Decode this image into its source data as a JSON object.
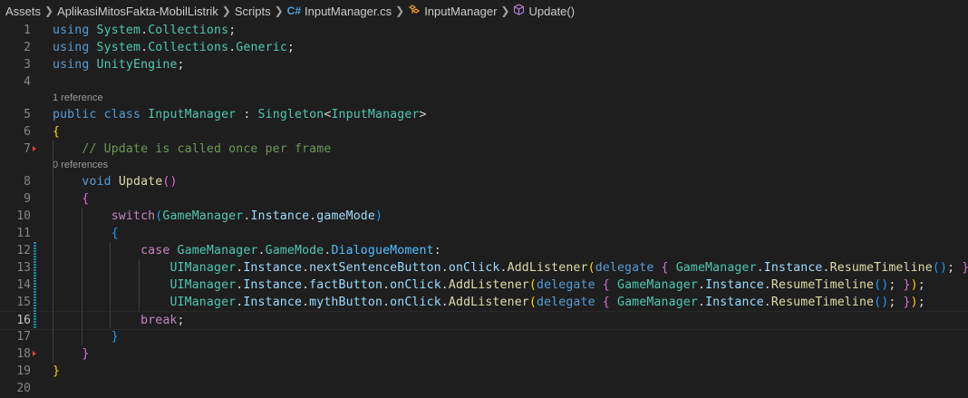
{
  "breadcrumb": {
    "items": [
      "Assets",
      "AplikasiMitosFakta-MobilListrik",
      "Scripts",
      "InputManager.cs",
      "InputManager",
      "Update()"
    ],
    "cs_glyph": "C#"
  },
  "lines": [
    {
      "n": "1",
      "html": "<span class='kw'>using</span> <span class='ns'>System</span>.<span class='ns'>Collections</span>;"
    },
    {
      "n": "2",
      "html": "<span class='kw'>using</span> <span class='ns'>System</span>.<span class='ns'>Collections</span>.<span class='ns'>Generic</span>;"
    },
    {
      "n": "3",
      "html": "<span class='kw'>using</span> <span class='ns'>UnityEngine</span>;"
    },
    {
      "n": "4",
      "html": ""
    },
    {
      "n": "5",
      "lens": "1 reference",
      "html": "<span class='kw'>public</span> <span class='kw'>class</span> <span class='cls'>InputManager</span> : <span class='cls'>Singleton</span>&lt;<span class='cls'>InputManager</span>&gt;"
    },
    {
      "n": "6",
      "html": "<span class='p1'>{</span>"
    },
    {
      "n": "7",
      "html": "    <span class='cm'>// Update is called once per frame</span>"
    },
    {
      "n": "8",
      "lens": "0 references",
      "html": "    <span class='kw'>void</span> <span class='fn'>Update</span><span class='p2'>()</span>"
    },
    {
      "n": "9",
      "html": "    <span class='p2'>{</span>"
    },
    {
      "n": "10",
      "html": "        <span class='ctl'>switch</span><span class='p3'>(</span><span class='cls'>GameManager</span>.<span class='prop'>Instance</span>.<span class='prop'>gameMode</span><span class='p3'>)</span>"
    },
    {
      "n": "11",
      "html": "        <span class='p3'>{</span>"
    },
    {
      "n": "12",
      "html": "            <span class='ctl'>case</span> <span class='cls'>GameManager</span>.<span class='cls'>GameMode</span>.<span class='en'>DialogueMoment</span>:"
    },
    {
      "n": "13",
      "html": "                <span class='cls'>UIManager</span>.<span class='prop'>Instance</span>.<span class='prop'>nextSentenceButton</span>.<span class='prop'>onClick</span>.<span class='fn'>AddListener</span><span class='p1'>(</span><span class='kw'>delegate</span> <span class='p2'>{</span> <span class='cls'>GameManager</span>.<span class='prop'>Instance</span>.<span class='fn'>ResumeTimeline</span><span class='p3'>()</span>; <span class='p2'>}</span><span class='p1'>)</span>;"
    },
    {
      "n": "14",
      "html": "                <span class='cls'>UIManager</span>.<span class='prop'>Instance</span>.<span class='prop'>factButton</span>.<span class='prop'>onClick</span>.<span class='fn'>AddListener</span><span class='p1'>(</span><span class='kw'>delegate</span> <span class='p2'>{</span> <span class='cls'>GameManager</span>.<span class='prop'>Instance</span>.<span class='fn'>ResumeTimeline</span><span class='p3'>()</span>; <span class='p2'>}</span><span class='p1'>)</span>;"
    },
    {
      "n": "15",
      "html": "                <span class='cls'>UIManager</span>.<span class='prop'>Instance</span>.<span class='prop'>mythButton</span>.<span class='prop'>onClick</span>.<span class='fn'>AddListener</span><span class='p1'>(</span><span class='kw'>delegate</span> <span class='p2'>{</span> <span class='cls'>GameManager</span>.<span class='prop'>Instance</span>.<span class='fn'>ResumeTimeline</span><span class='p3'>()</span>; <span class='p2'>}</span><span class='p1'>)</span>;"
    },
    {
      "n": "16",
      "active": true,
      "html": "            <span class='ctl'>break</span>;"
    },
    {
      "n": "17",
      "html": "        <span class='p3'>}</span>"
    },
    {
      "n": "18",
      "html": "    <span class='p2'>}</span>"
    },
    {
      "n": "19",
      "html": "<span class='p1'>}</span>"
    },
    {
      "n": "20",
      "html": ""
    }
  ],
  "colors": {
    "background": "#1e1e1e",
    "keyword": "#569cd6",
    "type": "#4ec9b0",
    "comment": "#6a9955",
    "function": "#dcdcaa"
  }
}
